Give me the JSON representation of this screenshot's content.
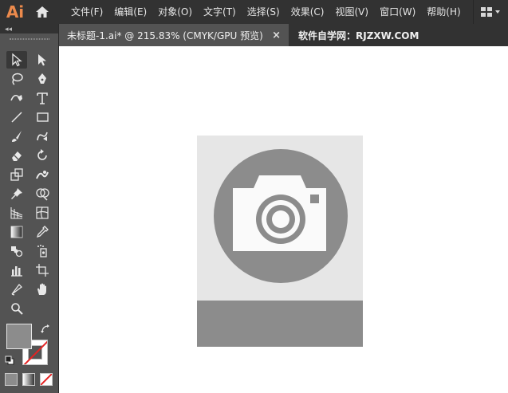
{
  "app": {
    "logo_text": "Ai",
    "menus": [
      "文件(F)",
      "编辑(E)",
      "对象(O)",
      "文字(T)",
      "选择(S)",
      "效果(C)",
      "视图(V)",
      "窗口(W)",
      "帮助(H)"
    ]
  },
  "tabs": {
    "active_label": "未标题-1.ai* @ 215.83% (CMYK/GPU 预览)",
    "close_glyph": "×",
    "second_label": "软件自学网：RJZXW.COM"
  },
  "toolbar": {
    "collapse_glyph": "◂◂"
  },
  "artwork": {
    "background_color": "#e6e6e6",
    "circle_color": "#8c8c8c",
    "camera_color": "#fafafa",
    "footer_color": "#8c8c8c"
  },
  "colors": {
    "fill": "#8c8c8c",
    "stroke": "none"
  }
}
